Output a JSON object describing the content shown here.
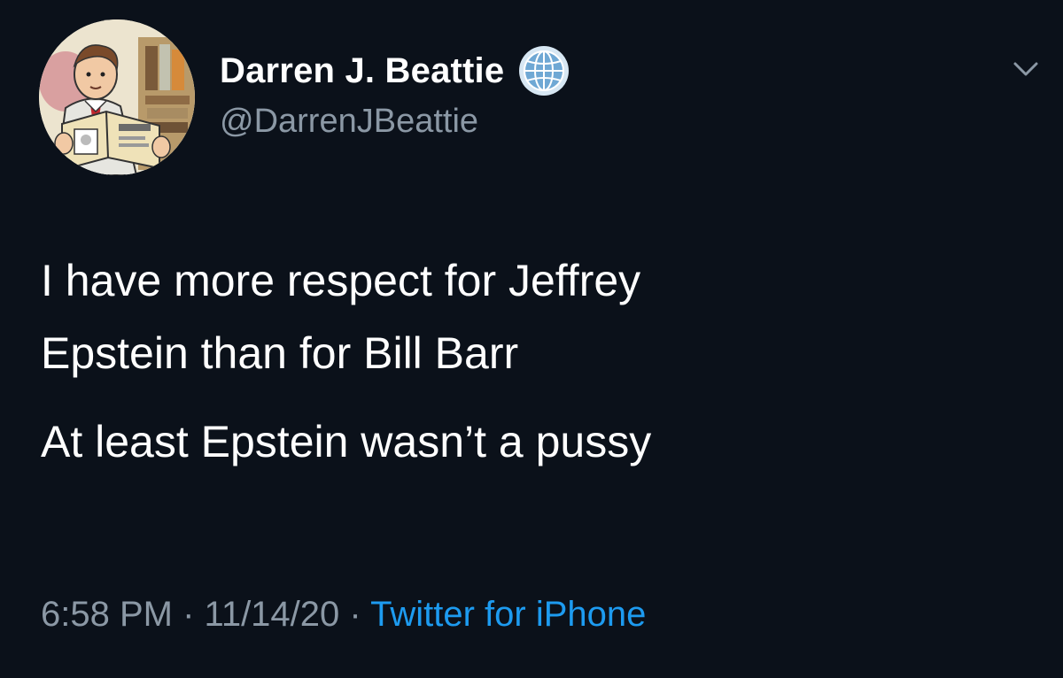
{
  "user": {
    "display_name": "Darren J. Beattie",
    "handle": "@DarrenJBeattie",
    "verified_icon": "globe-icon",
    "avatar_icon": "avatar"
  },
  "tweet": {
    "lines": [
      "I have more respect for Jeffrey",
      "Epstein than for Bill Barr",
      "At least Epstein wasn’t a pussy"
    ]
  },
  "meta": {
    "time": "6:58 PM",
    "separator": "·",
    "date": "11/14/20",
    "source": "Twitter for iPhone"
  },
  "menu": {
    "icon": "chevron-down-icon"
  },
  "colors": {
    "background": "#0b111a",
    "text": "#ffffff",
    "muted": "#8b98a5",
    "accent": "#1d9bf0"
  }
}
